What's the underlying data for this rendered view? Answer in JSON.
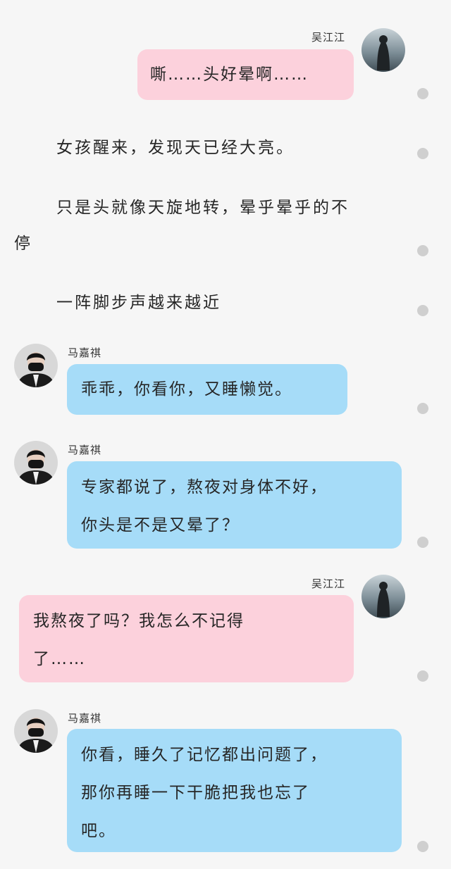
{
  "participants": {
    "wu": {
      "name": "吴江江"
    },
    "ma": {
      "name": "马嘉祺"
    }
  },
  "messages": [
    {
      "type": "bubble",
      "sender": "wu",
      "lines": [
        "嘶……头好晕啊……"
      ]
    },
    {
      "type": "narration",
      "lines": [
        "女孩醒来，发现天已经大亮。"
      ]
    },
    {
      "type": "narration",
      "lines": [
        "只是头就像天旋地转，晕乎晕乎的不",
        "停"
      ]
    },
    {
      "type": "narration",
      "lines": [
        "一阵脚步声越来越近"
      ]
    },
    {
      "type": "bubble",
      "sender": "ma",
      "lines": [
        "乖乖，你看你，又睡懒觉。"
      ]
    },
    {
      "type": "bubble",
      "sender": "ma",
      "lines": [
        "专家都说了，熬夜对身体不好，",
        "你头是不是又晕了？"
      ]
    },
    {
      "type": "bubble",
      "sender": "wu",
      "lines": [
        "我熬夜了吗？我怎么不记得",
        "了……"
      ]
    },
    {
      "type": "bubble",
      "sender": "ma",
      "lines": [
        "你看，睡久了记忆都出问题了，",
        "那你再睡一下干脆把我也忘了",
        "吧。"
      ]
    }
  ],
  "colors": {
    "pink_bubble": "#fcd1dc",
    "blue_bubble": "#a6dcf8",
    "background": "#f6f6f6"
  }
}
